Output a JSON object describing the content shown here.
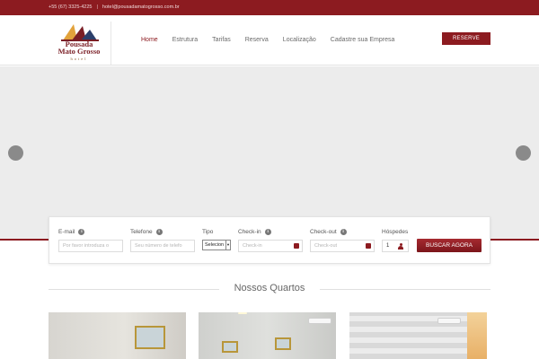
{
  "topbar": {
    "phone": "+55 (67) 3325-4225",
    "separator": "|",
    "email": "hotel@pousadamatogrosso.com.br"
  },
  "logo": {
    "line1": "Pousada",
    "line2": "Mato Grosso",
    "line3": "hotel"
  },
  "nav": {
    "items": [
      {
        "label": "Home"
      },
      {
        "label": "Estrutura"
      },
      {
        "label": "Tarifas"
      },
      {
        "label": "Reserva"
      },
      {
        "label": "Localização"
      },
      {
        "label": "Cadastre sua Empresa"
      }
    ],
    "active_index": 0
  },
  "header": {
    "reserve_label": "RESERVE AGORA"
  },
  "booking": {
    "email_label": "E-mail",
    "email_placeholder": "Por favor introduza o",
    "phone_label": "Telefone",
    "phone_placeholder": "Seu número de telefo",
    "type_label": "Tipo",
    "type_value": "Selecion",
    "checkin_label": "Check-in",
    "checkin_placeholder": "Check-in",
    "checkout_label": "Check-out",
    "checkout_placeholder": "Check-out",
    "guests_label": "Hóspedes",
    "guests_value": "1",
    "search_label": "BUSCAR AGORA"
  },
  "rooms_section": {
    "title": "Nossos Quartos"
  },
  "colors": {
    "brand": "#8c1b20",
    "hero_bg": "#ececec"
  },
  "icons": {
    "slider_prev": "circle-arrow-left-icon",
    "slider_next": "circle-arrow-right-icon",
    "info": "info-icon",
    "calendar": "calendar-icon",
    "user": "user-icon"
  }
}
